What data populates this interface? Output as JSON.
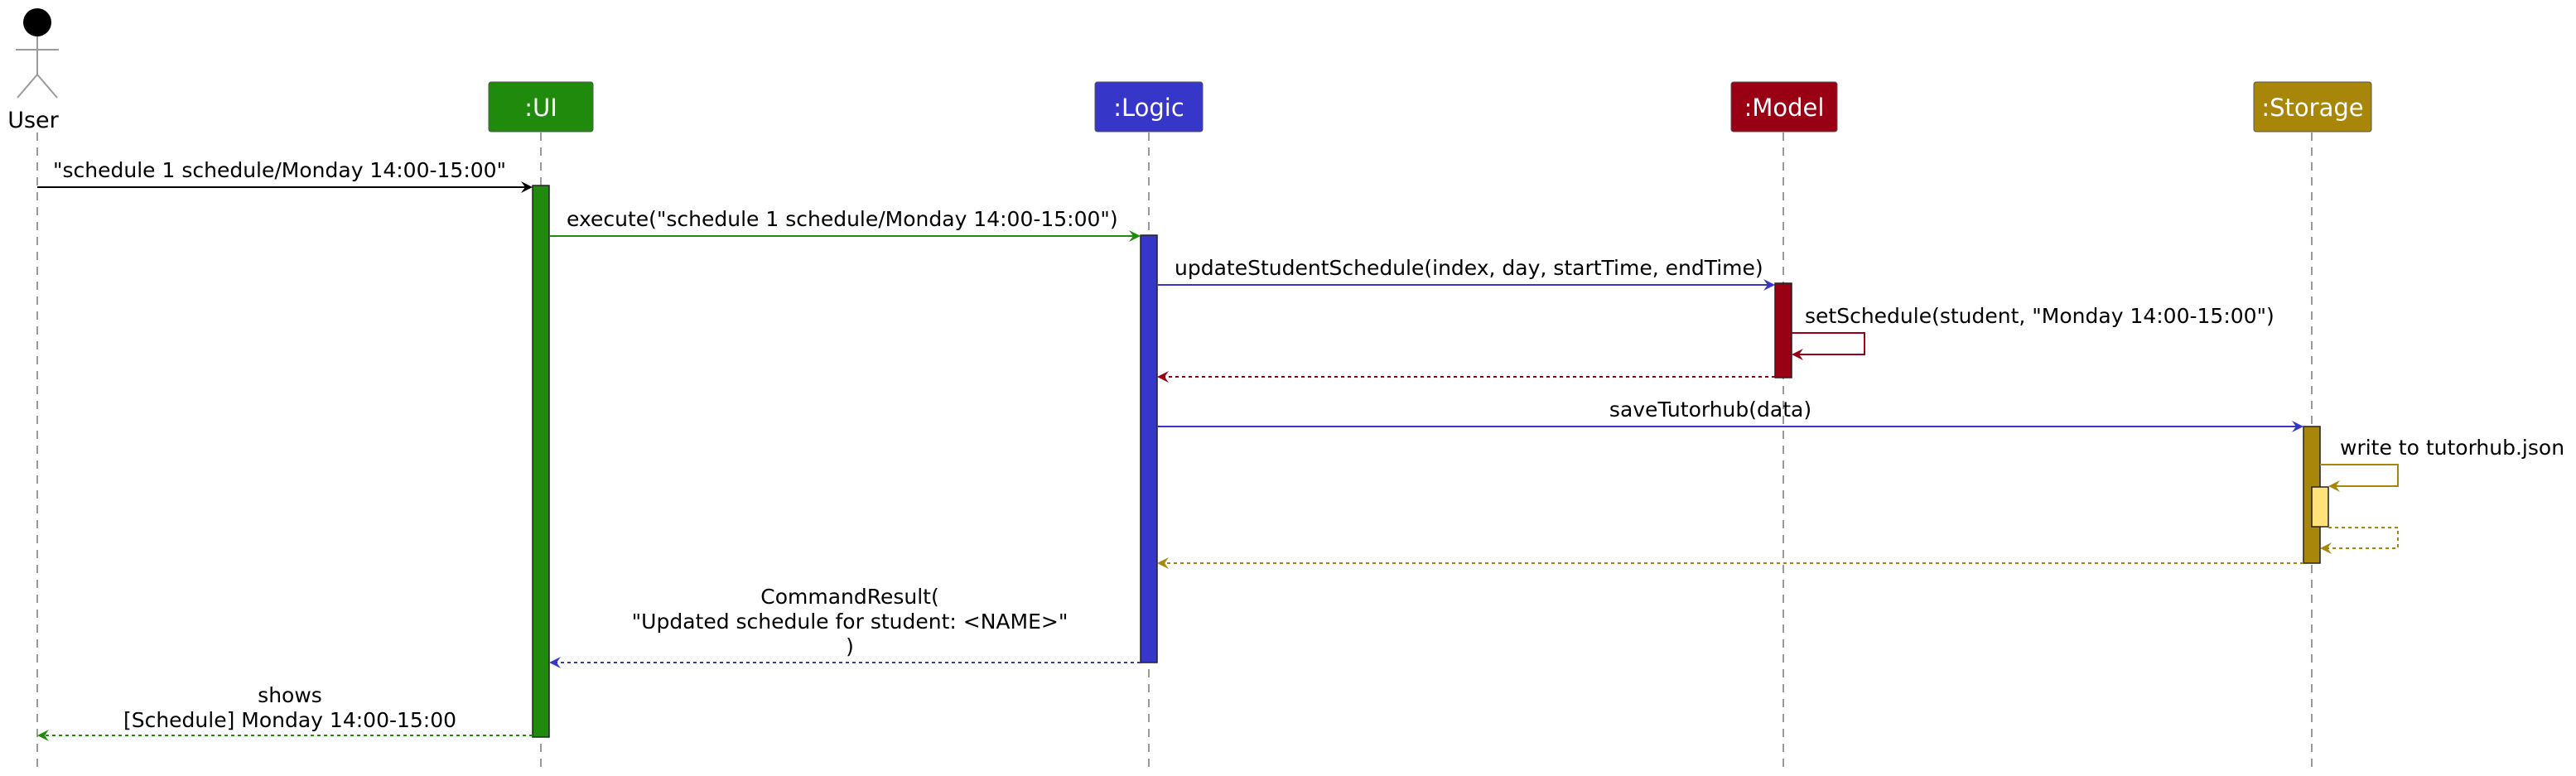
{
  "actor": {
    "label": "User"
  },
  "participants": [
    {
      "id": "ui",
      "label": ":UI",
      "color": "#1f8a0b"
    },
    {
      "id": "logic",
      "label": ":Logic",
      "color": "#3636c8"
    },
    {
      "id": "model",
      "label": ":Model",
      "color": "#990014"
    },
    {
      "id": "storage",
      "label": ":Storage",
      "color": "#a8860a"
    }
  ],
  "activation_colors": {
    "ui": "#1f8a0b",
    "logic": "#3636c8",
    "model": "#990014",
    "storage": "#a8860a",
    "storage_nested": "#ffe27a"
  },
  "messages": [
    {
      "id": "m1",
      "label": "\"schedule 1 schedule/Monday 14:00-15:00\""
    },
    {
      "id": "m2",
      "label": "execute(\"schedule 1 schedule/Monday 14:00-15:00\")"
    },
    {
      "id": "m3",
      "label": "updateStudentSchedule(index, day, startTime, endTime)"
    },
    {
      "id": "m4",
      "label": "setSchedule(student, \"Monday 14:00-15:00\")"
    },
    {
      "id": "m5",
      "label": ""
    },
    {
      "id": "m6",
      "label": "saveTutorhub(data)"
    },
    {
      "id": "m7",
      "label": "write to tutorhub.json"
    },
    {
      "id": "m8",
      "label": ""
    },
    {
      "id": "m9",
      "label": ""
    },
    {
      "id": "m10",
      "lines": [
        "CommandResult(",
        "\"Updated schedule for student: <NAME>\"",
        ")"
      ]
    },
    {
      "id": "m11",
      "lines": [
        "shows",
        "[Schedule] Monday 14:00-15:00"
      ]
    }
  ]
}
